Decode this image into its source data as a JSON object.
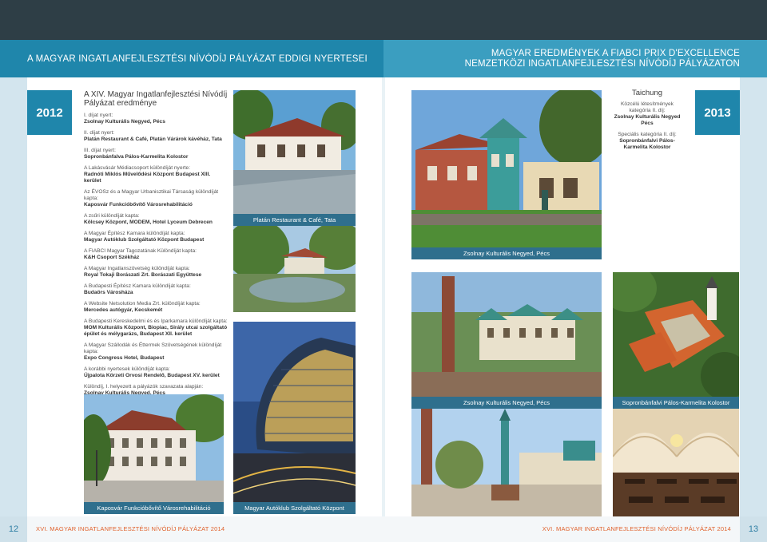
{
  "header": {
    "left_title": "A MAGYAR INGATLANFEJLESZTÉSI NÍVÓDÍJ PÁLYÁZAT EDDIGI NYERTESEI",
    "right_title_line1": "MAGYAR EREDMÉNYEK A FIABCI PRIX D'EXCELLENCE",
    "right_title_line2": "NEMZETKÖZI INGATLANFEJLESZTÉSI NÍVÓDÍJ PÁLYÁZATON"
  },
  "left_page": {
    "year": "2012",
    "heading": "A XIV. Magyar Ingatlanfejlesztési Nívódíj Pályázat eredménye",
    "awards": [
      {
        "label": "I. díjat nyert:",
        "value": "Zsolnay Kulturális Negyed, Pécs"
      },
      {
        "label": "II. díjat nyert:",
        "value": "Platán Restaurant & Café, Platán Várárok kávéház, Tata"
      },
      {
        "label": "III. díjat nyert:",
        "value": "Sopronbánfalva Pálos-Karmelita Kolostor"
      },
      {
        "label": "A Lakásvásár Médiacsoport különdíját nyerte:",
        "value": "Radnóti Miklós Művelődési Központ Budapest XIII. kerület"
      },
      {
        "label": "Az ÉVOSz és a Magyar Urbanisztikai Társaság különdíját kapta:",
        "value": "Kaposvár Funkcióbővítő Városrehabilitáció"
      },
      {
        "label": "A zsűri különdíját kapta:",
        "value": "Kölcsey Központ, MODEM, Hotel Lyceum Debrecen"
      },
      {
        "label": "A Magyar Építész Kamara különdíját kapta:",
        "value": "Magyar Autóklub Szolgáltató Központ Budapest"
      },
      {
        "label": "A FIABCI Magyar Tagozatának Különdíját kapta:",
        "value": "K&H Csoport Székház"
      },
      {
        "label": "A Magyar Ingatlanszövetség különdíját kapta:",
        "value": "Royal Tokaji Borászati Zrt. Borászati Együttese"
      },
      {
        "label": "A Budapesti Építész Kamara különdíját kapta:",
        "value": "Budaörs Városháza"
      },
      {
        "label": "A Website Netsolution Media Zrt. különdíját kapta:",
        "value": "Mercedes autógyár, Kecskemét"
      },
      {
        "label": "A Budapesti Kereskedelmi és és Iparkamara különdíját kapta:",
        "value": "MOM Kulturális Központ, Biopiac, Sirály utcai szolgáltató épület és mélygarázs, Budapest XII. kerület"
      },
      {
        "label": "A Magyar Szállodák és Éttermek Szövetségének különdíját kapta:",
        "value": "Expo Congress Hotel, Budapest"
      },
      {
        "label": "A korábbi nyertesek különdíját kapta:",
        "value": "Újpalota Körzeti Orvosi Rendelő, Budapest XV. kerület"
      },
      {
        "label": "Különdíj, I. helyezett a pályázók szavazata alapján:",
        "value": "Zsolnay Kulturális Negyed, Pécs"
      }
    ],
    "captions": {
      "platan": "Platán Restaurant & Café, Tata",
      "kaposvar": "Kaposvár Funkcióbővítő Városrehabilitáció",
      "autoklub": "Magyar Autóklub Szolgáltató Központ"
    },
    "page_number": "12",
    "footer": "XVI. MAGYAR INGATLANFEJLESZTÉSI NÍVÓDÍJ PÁLYÁZAT 2014"
  },
  "right_page": {
    "year": "2013",
    "city": "Taichung",
    "cat1_label": "Közcélú létesítmények kategória II. díj:",
    "cat1_value": "Zsolnay Kulturális Negyed Pécs",
    "cat2_label": "Speciális kategória II. díj:",
    "cat2_value": "Sopronbánfalvi Pálos-Karmelita Kolostor",
    "captions": {
      "zsolnay_top": "Zsolnay Kulturális Negyed, Pécs",
      "zsolnay_mid": "Zsolnay Kulturális Negyed, Pécs",
      "sopron": "Sopronbánfalvi Pálos-Karmelita Kolostor"
    },
    "page_number": "13",
    "footer": "XVI. MAGYAR INGATLANFEJLESZTÉSI NÍVÓDÍJ PÁLYÁZAT 2014"
  }
}
